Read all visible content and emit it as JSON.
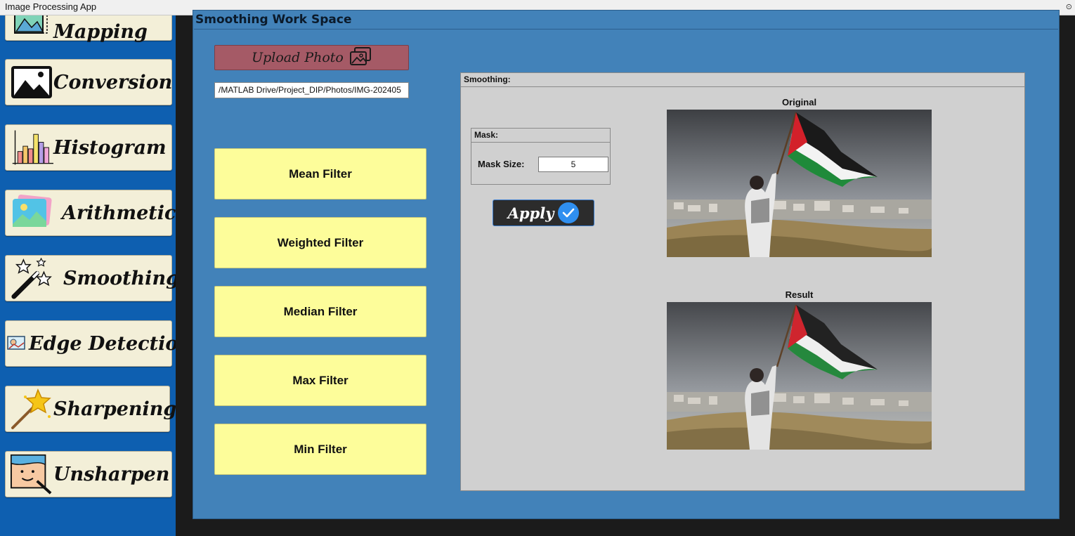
{
  "window": {
    "title": "Image Processing App"
  },
  "sidebar": {
    "items": [
      {
        "label": "Mapping",
        "icon": "mapping-icon"
      },
      {
        "label": "Conversion",
        "icon": "image-icon"
      },
      {
        "label": "Histogram",
        "icon": "histogram-icon"
      },
      {
        "label": "Arithmetic",
        "icon": "photos-icon"
      },
      {
        "label": "Smoothing",
        "icon": "magic-wand-icon"
      },
      {
        "label": "Edge Detection",
        "icon": "edge-image-icon"
      },
      {
        "label": "Sharpening",
        "icon": "star-wand-icon"
      },
      {
        "label": "Unsharpen",
        "icon": "face-wand-icon"
      }
    ]
  },
  "workspace": {
    "title": "Smoothing Work Space",
    "upload_label": "Upload Photo",
    "path_value": "/MATLAB Drive/Project_DIP/Photos/IMG-202405",
    "filters": [
      "Mean Filter",
      "Weighted Filter",
      "Median Filter",
      "Max Filter",
      "Min Filter"
    ]
  },
  "smoothing_panel": {
    "title": "Smoothing:",
    "mask": {
      "title": "Mask:",
      "size_label": "Mask Size:",
      "size_value": "5"
    },
    "apply_label": "Apply",
    "original_label": "Original",
    "result_label": "Result"
  },
  "colors": {
    "sidebar_bg": "#0e5fb0",
    "nav_button_bg": "#f3efd8",
    "workspace_bg": "#4282b9",
    "filter_button_bg": "#fdfd9a",
    "upload_button_bg": "#a55a66",
    "apply_button_bg": "#2c2c2c"
  }
}
